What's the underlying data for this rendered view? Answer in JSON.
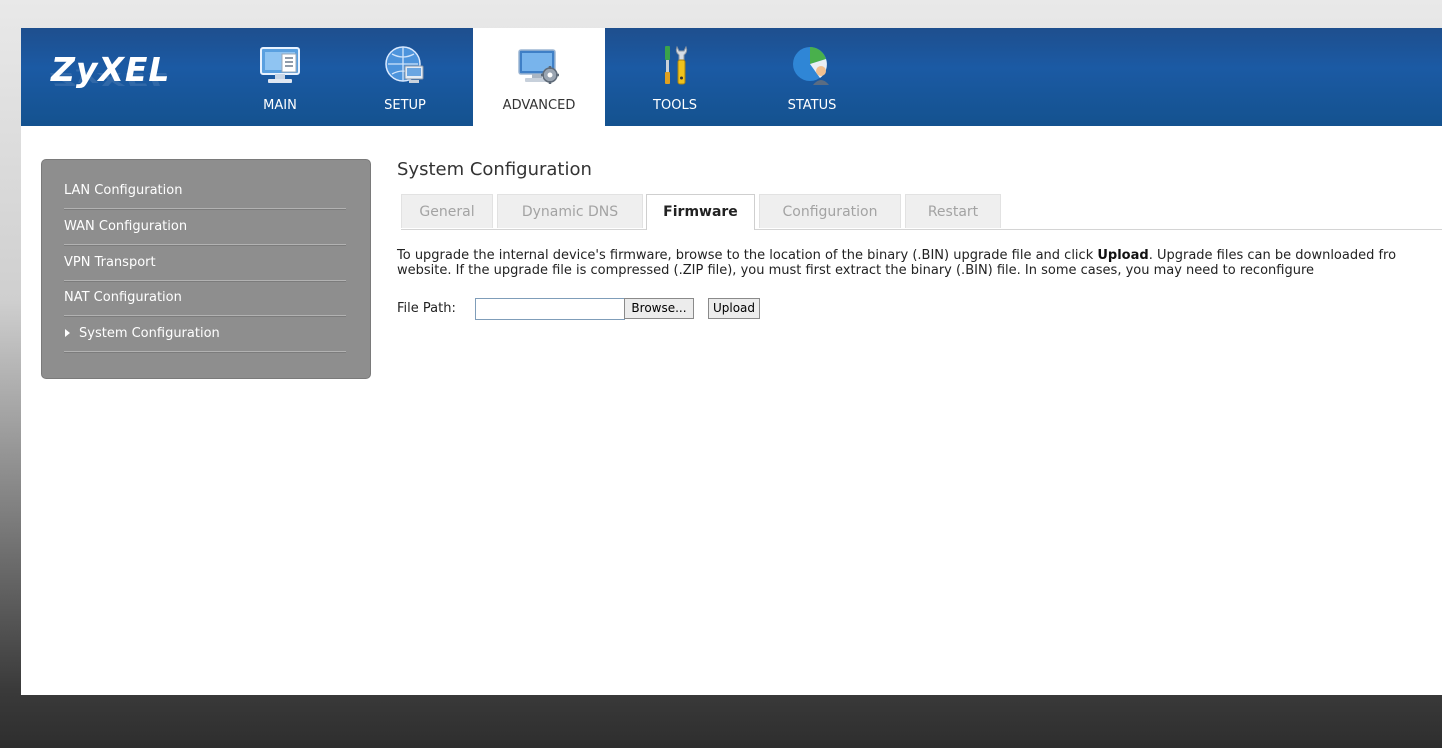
{
  "brand": {
    "logo_text": "ZyXEL"
  },
  "nav": {
    "tabs": [
      {
        "label": "MAIN",
        "icon": "monitor-document-icon"
      },
      {
        "label": "SETUP",
        "icon": "globe-computer-icon"
      },
      {
        "label": "ADVANCED",
        "icon": "monitor-gear-icon",
        "active": true
      },
      {
        "label": "TOOLS",
        "icon": "tools-icon"
      },
      {
        "label": "STATUS",
        "icon": "status-pie-icon"
      }
    ]
  },
  "sidebar": {
    "items": [
      {
        "label": "LAN Configuration"
      },
      {
        "label": "WAN Configuration"
      },
      {
        "label": "VPN Transport"
      },
      {
        "label": "NAT Configuration"
      },
      {
        "label": "System Configuration",
        "active": true
      }
    ]
  },
  "content": {
    "title": "System Configuration",
    "tabs": [
      {
        "label": "General"
      },
      {
        "label": "Dynamic DNS"
      },
      {
        "label": "Firmware",
        "active": true
      },
      {
        "label": "Configuration"
      },
      {
        "label": "Restart"
      }
    ],
    "description": {
      "line1_before": "To upgrade the internal device's firmware, browse to the location of the binary (.BIN) upgrade file and click ",
      "line1_bold": "Upload",
      "line1_after": ". Upgrade files can be downloaded fro",
      "line2": "website. If the upgrade file is compressed (.ZIP file), you must first extract the binary (.BIN) file. In some cases, you may need to reconfigure"
    },
    "file_path": {
      "label": "File Path:",
      "value": "",
      "browse_label": "Browse...",
      "upload_label": "Upload"
    }
  },
  "colors": {
    "header_blue": "#1b5aa4",
    "sidebar_gray": "#8e8e8e",
    "page_white": "#ffffff"
  }
}
